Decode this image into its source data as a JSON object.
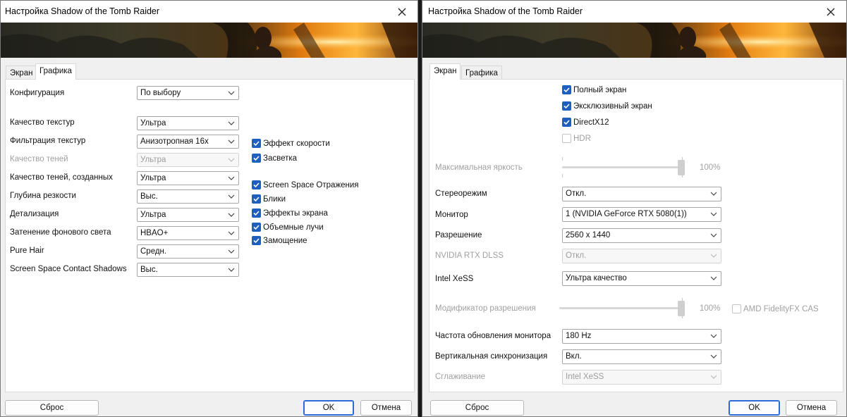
{
  "left_window": {
    "title": "Настройка Shadow of the Tomb Raider",
    "tabs": [
      "Экран",
      "Графика"
    ],
    "active_tab": "Графика",
    "rows": [
      {
        "label": "Конфигурация",
        "value": "По выбору",
        "disabled": false
      },
      {
        "label": "Качество текстур",
        "value": "Ультра",
        "disabled": false
      },
      {
        "label": "Фильтрация текстур",
        "value": "Анизотропная 16x",
        "disabled": false
      },
      {
        "label": "Качество теней",
        "value": "Ультра",
        "disabled": true
      },
      {
        "label": "Качество теней, созданных",
        "value": "Ультра",
        "disabled": false
      },
      {
        "label": "Глубина резкости",
        "value": "Выс.",
        "disabled": false
      },
      {
        "label": "Детализация",
        "value": "Ультра",
        "disabled": false
      },
      {
        "label": "Затенение фонового света",
        "value": "HBAO+",
        "disabled": false
      },
      {
        "label": "Pure Hair",
        "value": "Средн.",
        "disabled": false
      },
      {
        "label": "Screen Space Contact Shadows",
        "value": "Выс.",
        "disabled": false
      }
    ],
    "checkboxes": [
      {
        "label": "Эффект скорости",
        "checked": true
      },
      {
        "label": "Засветка",
        "checked": true
      },
      {
        "label": "Screen Space Отражения",
        "checked": true
      },
      {
        "label": "Блики",
        "checked": true
      },
      {
        "label": "Эффекты экрана",
        "checked": true
      },
      {
        "label": "Объемные лучи",
        "checked": true
      },
      {
        "label": "Замощение",
        "checked": true
      }
    ],
    "buttons": {
      "reset": "Сброс",
      "ok": "OK",
      "cancel": "Отмена"
    }
  },
  "right_window": {
    "title": "Настройка Shadow of the Tomb Raider",
    "tabs": [
      "Экран",
      "Графика"
    ],
    "active_tab": "Экран",
    "checkboxes": [
      {
        "label": "Полный экран",
        "checked": true,
        "disabled": false
      },
      {
        "label": "Эксклюзивный экран",
        "checked": true,
        "disabled": false
      },
      {
        "label": "DirectX12",
        "checked": true,
        "disabled": false
      },
      {
        "label": "HDR",
        "checked": false,
        "disabled": true
      }
    ],
    "max_brightness": {
      "label": "Максимальная яркость",
      "value_text": "100%",
      "level": 1.0,
      "disabled": true
    },
    "rows": [
      {
        "label": "Стереорежим",
        "value": "Откл.",
        "disabled": false
      },
      {
        "label": "Монитор",
        "value": "1 (NVIDIA GeForce RTX 5080(1))",
        "disabled": false
      },
      {
        "label": "Разрешение",
        "value": "2560 x 1440",
        "disabled": false
      },
      {
        "label": "NVIDIA RTX DLSS",
        "value": "Откл.",
        "disabled": true
      },
      {
        "label": "Intel XeSS",
        "value": "Ультра качество",
        "disabled": false
      }
    ],
    "resolution_modifier": {
      "label": "Модификатор разрешения",
      "value_text": "100%",
      "level": 1.0,
      "disabled": true
    },
    "cas_checkbox": {
      "label": "AMD FidelityFX CAS",
      "checked": false,
      "disabled": true
    },
    "rows2": [
      {
        "label": "Частота обновления монитора",
        "value": "180 Hz",
        "disabled": false
      },
      {
        "label": "Вертикальная синхронизация",
        "value": "Вкл.",
        "disabled": false
      },
      {
        "label": "Сглаживание",
        "value": "Intel XeSS",
        "disabled": true
      }
    ],
    "buttons": {
      "reset": "Сброс",
      "ok": "OK",
      "cancel": "Отмена"
    }
  }
}
